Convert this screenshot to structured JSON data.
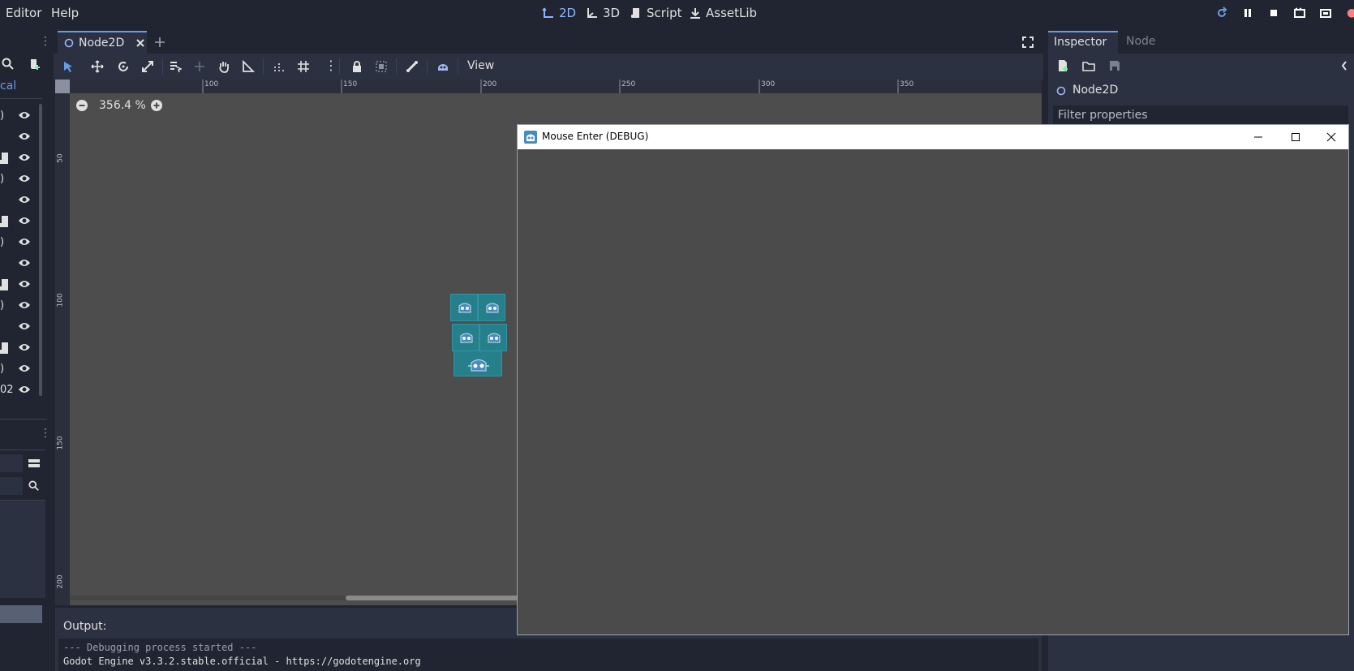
{
  "menubar": {
    "editor_label": "Editor",
    "help_label": "Help",
    "modes": [
      {
        "label": "2D",
        "icon": "2d-axes-icon",
        "active": true
      },
      {
        "label": "3D",
        "icon": "3d-axes-icon",
        "active": false
      },
      {
        "label": "Script",
        "icon": "script-icon",
        "active": false
      },
      {
        "label": "AssetLib",
        "icon": "download-icon",
        "active": false
      }
    ]
  },
  "left_dock": {
    "filter_tab_fragment": "cal",
    "last_row_fragment": "02"
  },
  "scene_tabs": {
    "active_tab_label": "Node2D"
  },
  "toolbar": {
    "view_menu_label": "View"
  },
  "viewport": {
    "zoom_label": "356.4 %",
    "ruler_top_labels": [
      "100",
      "150",
      "200",
      "250",
      "300",
      "350"
    ],
    "ruler_left_labels": [
      "50",
      "100",
      "150",
      "200"
    ]
  },
  "output": {
    "title": "Output:",
    "lines": [
      "--- Debugging process started ---",
      "Godot Engine v3.3.2.stable.official - https://godotengine.org"
    ]
  },
  "inspector": {
    "tab_inspector": "Inspector",
    "tab_node": "Node",
    "selected_node": "Node2D",
    "filter_placeholder": "Filter properties"
  },
  "debug_window": {
    "title": "Mouse Enter (DEBUG)"
  },
  "colors": {
    "accent": "#699ce8",
    "editor_bg": "#202531",
    "panel_bg": "#2b3140",
    "viewport_bg": "#4d4d4d",
    "debug_bg": "#4b4b4b",
    "sprite_teal": "#26808c"
  }
}
